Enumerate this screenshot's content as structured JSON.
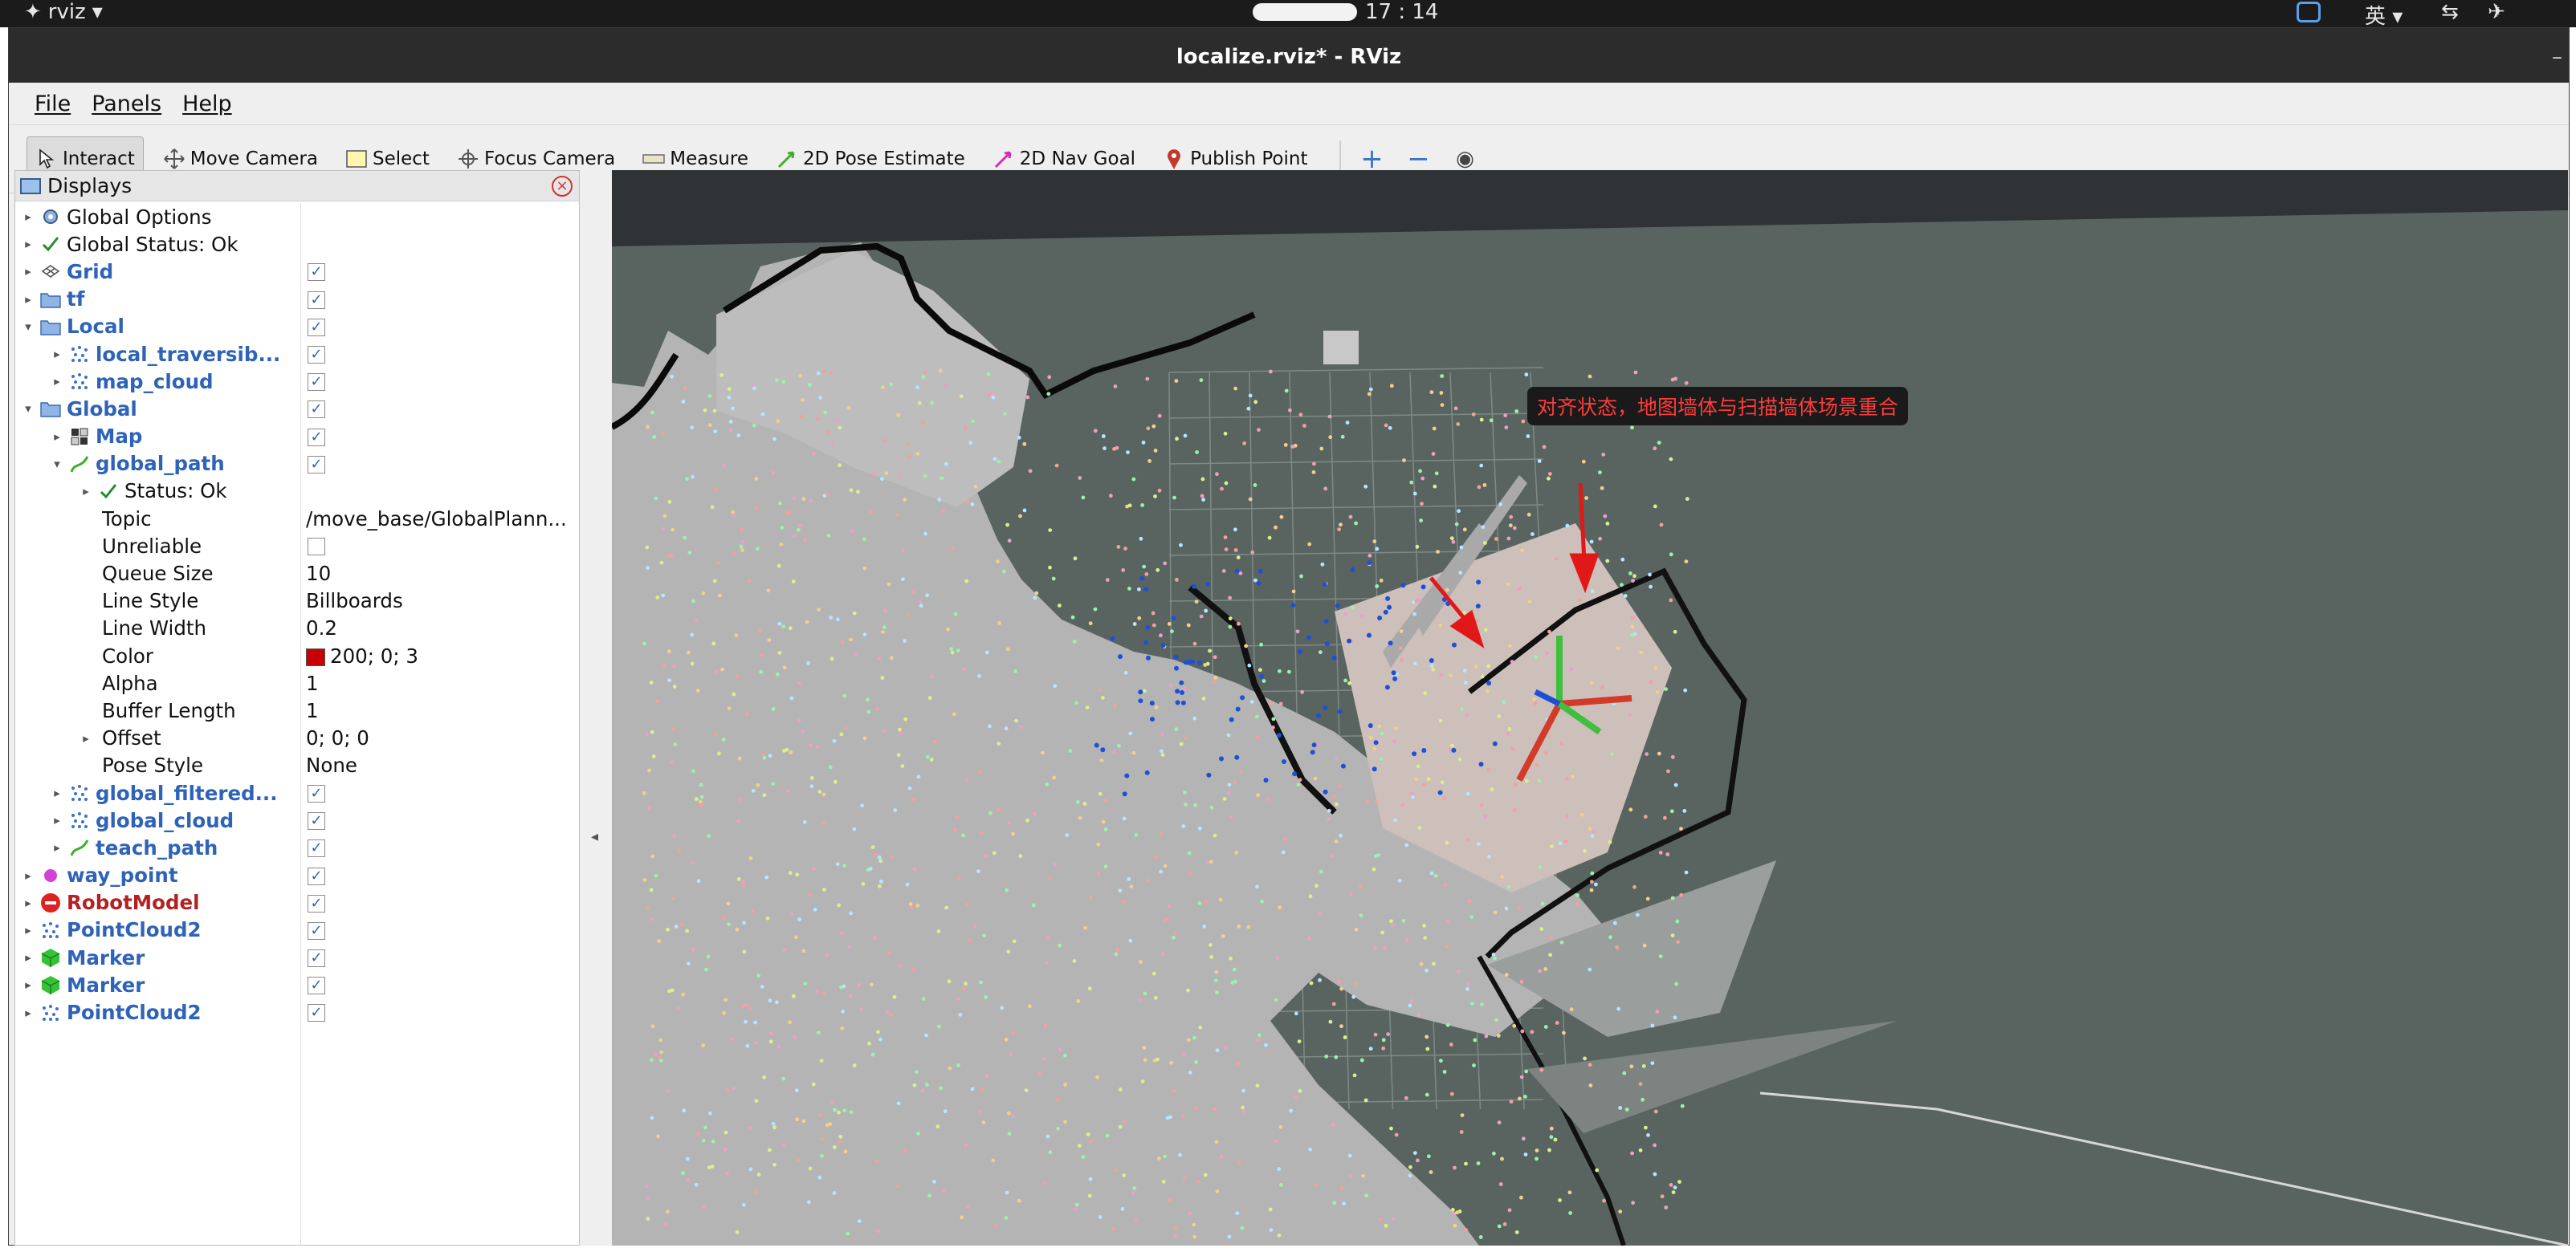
{
  "topbar": {
    "app_name": "rviz",
    "clock": "17 : 14",
    "input_method": "英"
  },
  "window": {
    "title": "localize.rviz* - RViz"
  },
  "menu": {
    "file": "File",
    "panels": "Panels",
    "help": "Help"
  },
  "toolbar": {
    "interact": "Interact",
    "move_camera": "Move Camera",
    "select": "Select",
    "focus_camera": "Focus Camera",
    "measure": "Measure",
    "pose_estimate": "2D Pose Estimate",
    "nav_goal": "2D Nav Goal",
    "publish_point": "Publish Point"
  },
  "displays": {
    "title": "Displays",
    "rows": [
      {
        "label": "Global Options"
      },
      {
        "label": "Global Status: Ok"
      },
      {
        "label": "Grid",
        "checked": true
      },
      {
        "label": "tf",
        "checked": true
      },
      {
        "label": "Local",
        "checked": true
      },
      {
        "label": "local_traversib...",
        "checked": true
      },
      {
        "label": "map_cloud",
        "checked": true
      },
      {
        "label": "Global",
        "checked": true
      },
      {
        "label": "Map",
        "checked": true
      },
      {
        "label": "global_path",
        "checked": true
      },
      {
        "label": "Status: Ok"
      },
      {
        "label": "Topic",
        "value": "/move_base/GlobalPlann..."
      },
      {
        "label": "Unreliable",
        "checked": false
      },
      {
        "label": "Queue Size",
        "value": "10"
      },
      {
        "label": "Line Style",
        "value": "Billboards"
      },
      {
        "label": "Line Width",
        "value": "0.2"
      },
      {
        "label": "Color",
        "value": "200; 0; 3"
      },
      {
        "label": "Alpha",
        "value": "1"
      },
      {
        "label": "Buffer Length",
        "value": "1"
      },
      {
        "label": "Offset",
        "value": "0; 0; 0"
      },
      {
        "label": "Pose Style",
        "value": "None"
      },
      {
        "label": "global_filtered...",
        "checked": true
      },
      {
        "label": "global_cloud",
        "checked": true
      },
      {
        "label": "teach_path",
        "checked": true
      },
      {
        "label": "way_point",
        "checked": true
      },
      {
        "label": "RobotModel",
        "checked": true
      },
      {
        "label": "PointCloud2",
        "checked": true
      },
      {
        "label": "Marker",
        "checked": true
      },
      {
        "label": "Marker",
        "checked": true
      },
      {
        "label": "PointCloud2",
        "checked": true
      }
    ]
  },
  "view": {
    "annotation": "对齐状态，地图墙体与扫描墙体场景重合"
  },
  "colors": {
    "path_color": "#c80003",
    "accent_blue": "#2e63b8",
    "annotation_text": "#ff3b3b"
  }
}
